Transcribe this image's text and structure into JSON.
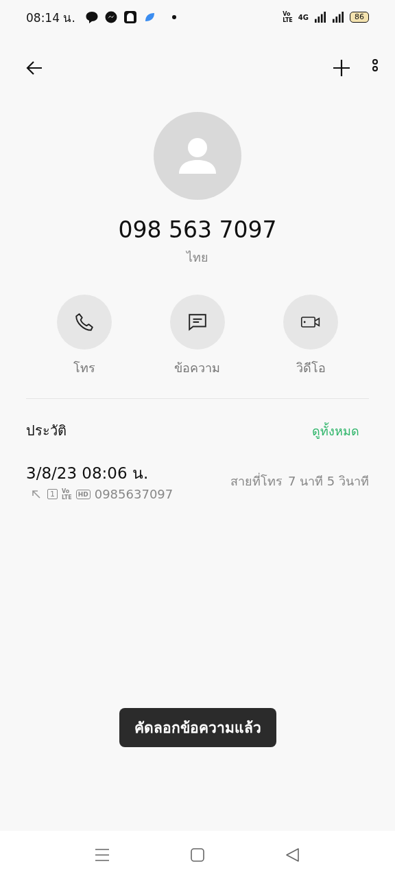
{
  "status_bar": {
    "time": "08:14 น.",
    "volte": [
      "Vo",
      "LTE"
    ],
    "network": "4G",
    "battery": "86"
  },
  "contact": {
    "number": "098 563 7097",
    "location": "ไทย"
  },
  "actions": [
    {
      "kind": "call",
      "label": "โทร"
    },
    {
      "kind": "message",
      "label": "ข้อความ"
    },
    {
      "kind": "video",
      "label": "วิดีโอ"
    }
  ],
  "history": {
    "title": "ประวัติ",
    "see_all": "ดูทั้งหมด",
    "entries": [
      {
        "datetime": "3/8/23 08:06 น.",
        "sim": "1",
        "volte": [
          "Vo",
          "LTE"
        ],
        "hd": "HD",
        "number": "0985637097",
        "type": "สายที่โทร",
        "duration": "7 นาที 5 วินาที"
      }
    ]
  },
  "toast": "คัดลอกข้อความแล้ว"
}
